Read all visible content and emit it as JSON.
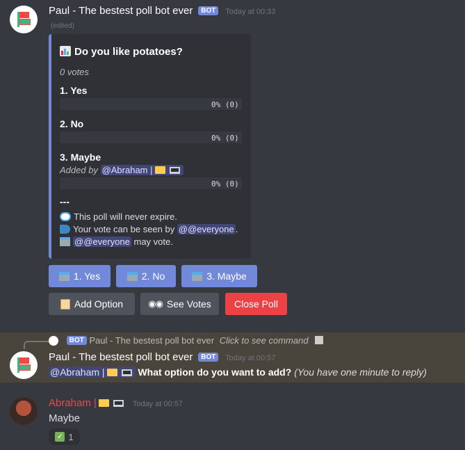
{
  "msg1": {
    "author": "Paul - The bestest poll bot ever",
    "bot_badge": "BOT",
    "timestamp": "Today at 00:33",
    "edited": "(edited)",
    "embed": {
      "title": "Do you like potatoes?",
      "votes": "0 votes",
      "options": [
        {
          "label": "1. Yes",
          "pct": "0% (0)"
        },
        {
          "label": "2. No",
          "pct": "0% (0)"
        },
        {
          "label": "3. Maybe",
          "pct": "0% (0)"
        }
      ],
      "added_by_prefix": "Added by",
      "added_by_user": "@Abraham |",
      "dashes": "---",
      "expire": "This poll will never expire.",
      "visibility_prefix": "Your vote can be seen by",
      "visibility_mention": "@@everyone",
      "voters_mention": "@@everyone",
      "voters_suffix": "may vote."
    },
    "buttons": {
      "yes": "1. Yes",
      "no": "2. No",
      "maybe": "3. Maybe",
      "add_option": "Add Option",
      "see_votes": "See Votes",
      "close_poll": "Close Poll"
    }
  },
  "msg2": {
    "reply_badge": "BOT",
    "reply_author": "Paul - The bestest poll bot ever",
    "reply_hint": "Click to see command",
    "author": "Paul - The bestest poll bot ever",
    "bot_badge": "BOT",
    "timestamp": "Today at 00:57",
    "mention": "@Abraham |",
    "question": "What option do you want to add?",
    "note": "(You have one minute to reply)"
  },
  "msg3": {
    "author": "Abraham |",
    "timestamp": "Today at 00:57",
    "text": "Maybe",
    "reaction_count": "1"
  },
  "colors": {
    "background": "#36393f",
    "embed_bg": "#2f3136",
    "accent": "#7289da",
    "danger": "#ed4245",
    "highlight": "#49443c",
    "user_name": "#f04747"
  }
}
